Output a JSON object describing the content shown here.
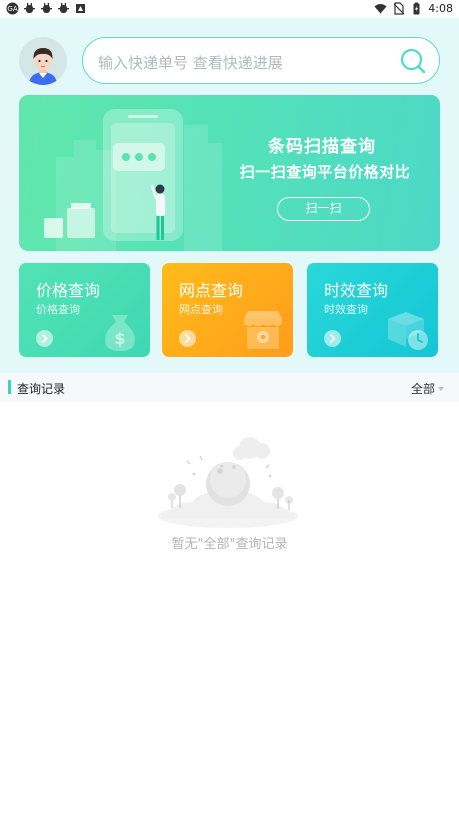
{
  "status_bar": {
    "time": "4:08",
    "left_icons": [
      "app-logo-icon",
      "bug-icon",
      "bug-icon",
      "bug-icon",
      "notification-box-icon"
    ],
    "right_icons": [
      "wifi-icon",
      "no-sim-icon",
      "battery-icon"
    ]
  },
  "header": {
    "search_placeholder": "输入快递单号 查看快递进展"
  },
  "banner": {
    "title": "条码扫描查询",
    "subtitle": "扫一扫查询平台价格对比",
    "button_label": "扫一扫"
  },
  "cards": [
    {
      "title": "价格查询",
      "subtitle": "价格查询",
      "color": "#4fe0b4",
      "icon": "money-bag-icon"
    },
    {
      "title": "网点查询",
      "subtitle": "网点查询",
      "color": "#ffad1a",
      "icon": "store-icon"
    },
    {
      "title": "时效查询",
      "subtitle": "时效查询",
      "color": "#1fcfd7",
      "icon": "box-clock-icon"
    }
  ],
  "records": {
    "title": "查询记录",
    "filter_label": "全部",
    "empty_text": "暂无\"全部\"查询记录"
  },
  "colors": {
    "accent": "#36d6c4",
    "top_background": "#e3f8f9"
  }
}
